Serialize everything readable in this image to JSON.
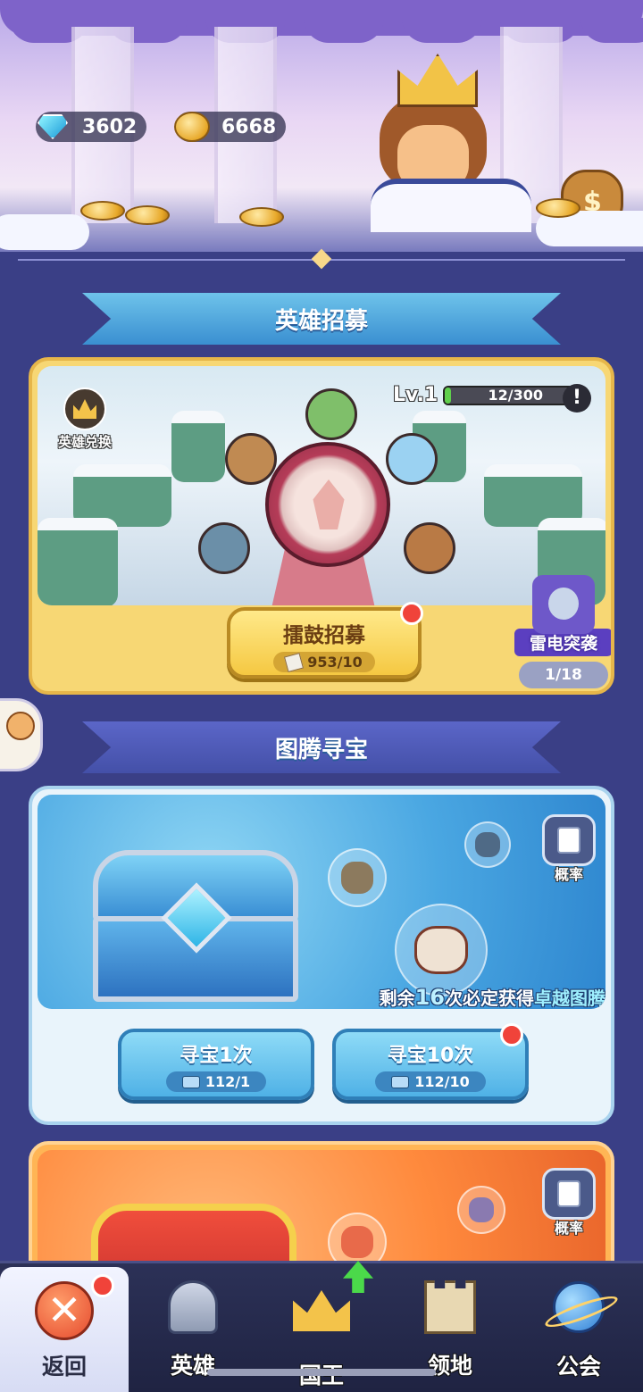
{
  "currency": {
    "gems": {
      "icon": "diamond-icon",
      "value": "3602"
    },
    "gold": {
      "icon": "gold-coin-icon",
      "value": "6668"
    }
  },
  "recruit": {
    "section_title": "英雄招募",
    "exchange_label": "英雄兑换",
    "level_label": "Lv.1",
    "level_progress": {
      "current": 12,
      "max": 300,
      "text": "12/300"
    },
    "info_icon": "!",
    "drum_button": {
      "label": "擂鼓招募",
      "cost": "953/10",
      "cost_icon": "scroll-icon",
      "has_notice": true
    },
    "event": {
      "label": "雷电突袭",
      "count": "1/18"
    }
  },
  "treasure": {
    "section_title": "图腾寻宝",
    "probability_label": "概率",
    "hint": {
      "prefix": "剩余",
      "number": "16",
      "mid": "次必定获得",
      "highlight": "卓越图腾"
    },
    "buttons": [
      {
        "label": "寻宝1次",
        "cost": "112/1",
        "has_notice": false
      },
      {
        "label": "寻宝10次",
        "cost": "112/10",
        "has_notice": true
      }
    ]
  },
  "orange_card": {
    "probability_label": "概率"
  },
  "nav": {
    "items": [
      {
        "label": "返回",
        "icon": "close-icon",
        "active": true,
        "has_notice": true
      },
      {
        "label": "英雄",
        "icon": "helmet-icon"
      },
      {
        "label": "国王",
        "icon": "crown-icon",
        "upgrade_arrow": true
      },
      {
        "label": "领地",
        "icon": "castle-icon"
      },
      {
        "label": "公会",
        "icon": "planet-icon"
      }
    ]
  },
  "colors": {
    "background": "#3a3f86",
    "gold_button": "#f5c842",
    "blue_button": "#4fb1e6",
    "notice_red": "#f0433a",
    "progress_green": "#5fcf4c"
  }
}
